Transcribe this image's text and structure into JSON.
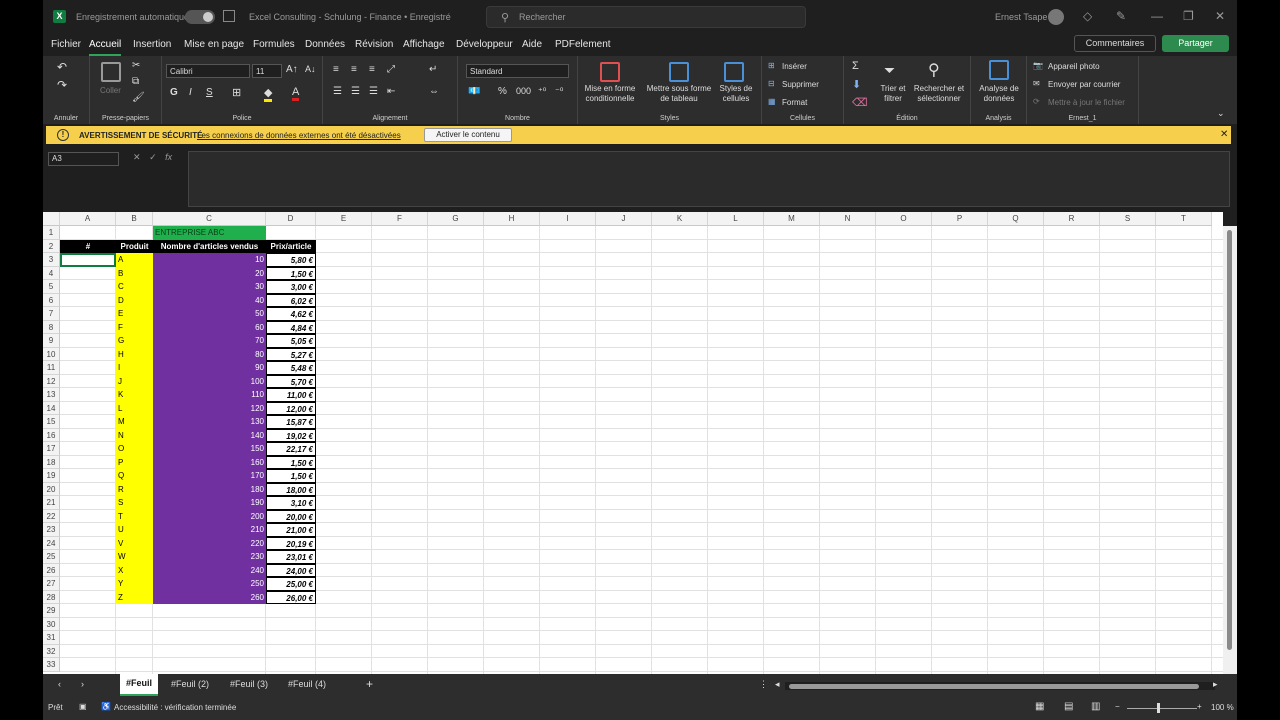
{
  "window": {
    "autosave_label": "Enregistrement automatique",
    "doc_title": "Excel Consulting - Schulung - Finance • Enregistré",
    "search_placeholder": "Rechercher",
    "user_name": "Ernest Tsape"
  },
  "menu": {
    "tabs": [
      "Fichier",
      "Accueil",
      "Insertion",
      "Mise en page",
      "Formules",
      "Données",
      "Révision",
      "Affichage",
      "Développeur",
      "Aide",
      "PDFelement"
    ],
    "active_tab": "Accueil",
    "comments_label": "Commentaires",
    "share_label": "Partager"
  },
  "ribbon": {
    "undo_group": "Annuler",
    "clipboard_group": "Presse-papiers",
    "paste_label": "Coller",
    "font_group": "Police",
    "font_name": "Calibri",
    "font_size": "11",
    "bold": "G",
    "italic": "I",
    "underline": "S",
    "alignment_group": "Alignement",
    "number_group": "Nombre",
    "number_format": "Standard",
    "styles_group": "Styles",
    "cond_format": "Mise en forme conditionnelle",
    "format_table": "Mettre sous forme de tableau",
    "cell_styles": "Styles de cellules",
    "cells_group": "Cellules",
    "insert": "Insérer",
    "delete": "Supprimer",
    "format": "Format",
    "edit_group": "Édition",
    "sort_filter": "Trier et filtrer",
    "find_select": "Rechercher et sélectionner",
    "analysis_group": "Analysis",
    "analyze_data": "Analyse de données",
    "ernest_group": "Ernest_1",
    "camera": "Appareil photo",
    "send_mail": "Envoyer par courrier",
    "update_file": "Mettre à jour le fichier"
  },
  "warning": {
    "title": "AVERTISSEMENT DE SÉCURITÉ",
    "message": "Les connexions de données externes ont été désactivées",
    "button": "Activer le contenu"
  },
  "formula_bar": {
    "name_box": "A3",
    "fx": "fx"
  },
  "sheet": {
    "columns": [
      "A",
      "B",
      "C",
      "D",
      "E",
      "F",
      "G",
      "H",
      "I",
      "J",
      "K",
      "L",
      "M",
      "N",
      "O",
      "P",
      "Q",
      "R",
      "S",
      "T"
    ],
    "row_count": 33,
    "title_cell": "ENTREPRISE ABC",
    "headers": [
      "#",
      "Produit",
      "Nombre d'articles vendus",
      "Prix/article"
    ],
    "rows": [
      [
        "A",
        "10",
        "5,80 €"
      ],
      [
        "B",
        "20",
        "1,50 €"
      ],
      [
        "C",
        "30",
        "3,00 €"
      ],
      [
        "D",
        "40",
        "6,02 €"
      ],
      [
        "E",
        "50",
        "4,62 €"
      ],
      [
        "F",
        "60",
        "4,84 €"
      ],
      [
        "G",
        "70",
        "5,05 €"
      ],
      [
        "H",
        "80",
        "5,27 €"
      ],
      [
        "I",
        "90",
        "5,48 €"
      ],
      [
        "J",
        "100",
        "5,70 €"
      ],
      [
        "K",
        "110",
        "11,00 €"
      ],
      [
        "L",
        "120",
        "12,00 €"
      ],
      [
        "M",
        "130",
        "15,87 €"
      ],
      [
        "N",
        "140",
        "19,02 €"
      ],
      [
        "O",
        "150",
        "22,17 €"
      ],
      [
        "P",
        "160",
        "1,50 €"
      ],
      [
        "Q",
        "170",
        "1,50 €"
      ],
      [
        "R",
        "180",
        "18,00 €"
      ],
      [
        "S",
        "190",
        "3,10 €"
      ],
      [
        "T",
        "200",
        "20,00 €"
      ],
      [
        "U",
        "210",
        "21,00 €"
      ],
      [
        "V",
        "220",
        "20,19 €"
      ],
      [
        "W",
        "230",
        "23,01 €"
      ],
      [
        "X",
        "240",
        "24,00 €"
      ],
      [
        "Y",
        "250",
        "25,00 €"
      ],
      [
        "Z",
        "260",
        "26,00 €"
      ]
    ],
    "colors": {
      "title_bg": "#1fb04d",
      "produit_bg": "#ffff00",
      "qty_bg": "#7030a0",
      "header_bg": "#000000"
    }
  },
  "tabs": {
    "sheets": [
      "#Feuil",
      "#Feuil (2)",
      "#Feuil (3)",
      "#Feuil (4)"
    ],
    "active": "#Feuil"
  },
  "status": {
    "ready": "Prêt",
    "accessibility": "Accessibilité : vérification terminée",
    "zoom": "100 %"
  }
}
